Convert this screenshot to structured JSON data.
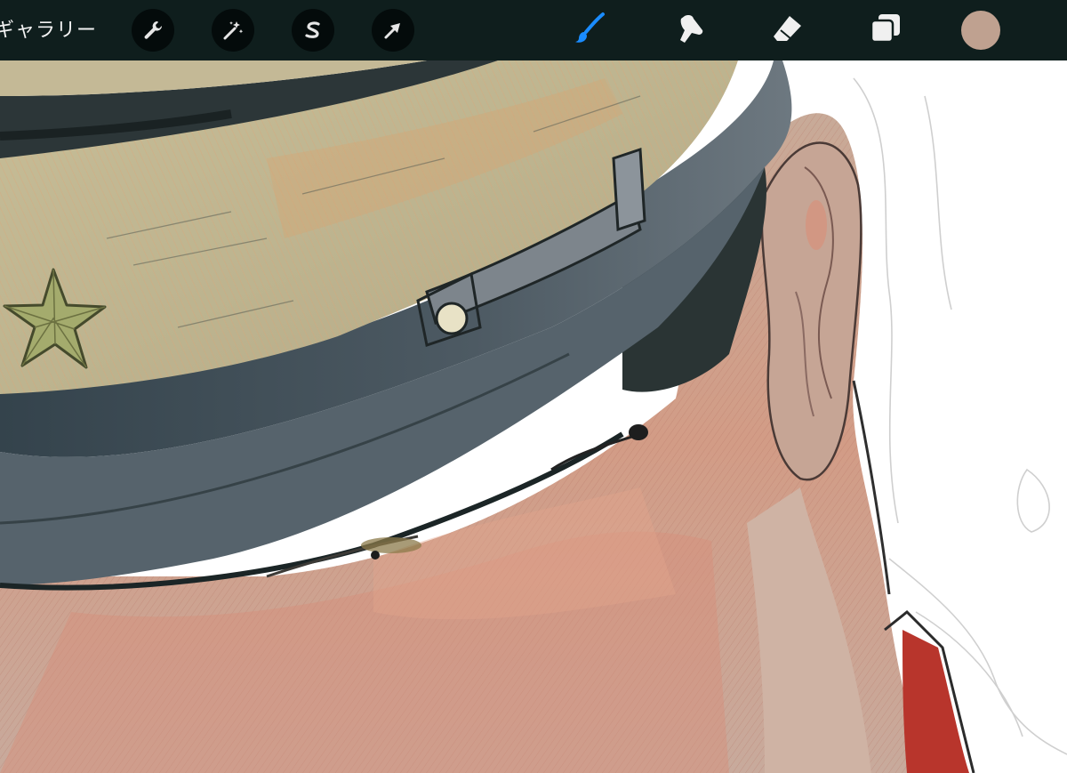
{
  "toolbar": {
    "gallery_label": "ギャラリー",
    "left_tools": [
      {
        "name": "actions-wrench-icon"
      },
      {
        "name": "adjustments-magic-wand-icon"
      },
      {
        "name": "selection-s-icon"
      },
      {
        "name": "transform-arrow-icon"
      }
    ],
    "right_tools": [
      {
        "name": "brush-icon",
        "active": true
      },
      {
        "name": "smudge-icon",
        "active": false
      },
      {
        "name": "eraser-icon",
        "active": false
      },
      {
        "name": "layers-icon",
        "active": false
      }
    ],
    "current_color": "#bfa190",
    "active_tool_color": "#1a8cff"
  },
  "colors": {
    "toolbar_bg": "#0f1e1d",
    "canvas_bg": "#ffffff",
    "cap_body": "#bdb48f",
    "cap_band": "#3c4a54",
    "skin": "#c99c86",
    "collar_red": "#b8352c"
  }
}
